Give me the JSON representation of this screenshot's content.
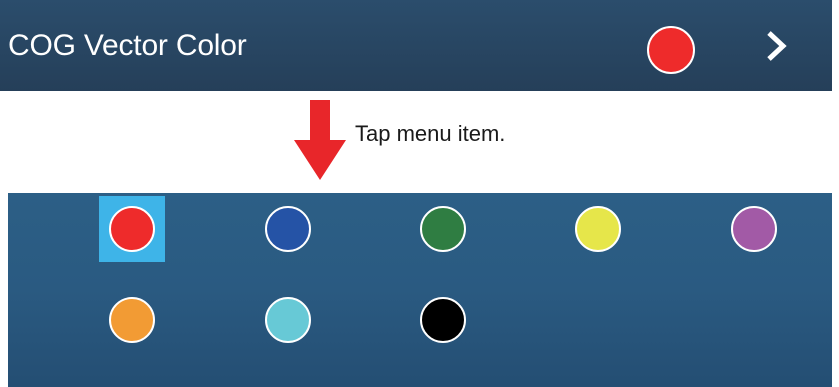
{
  "menu": {
    "label": "COG Vector Color",
    "current_color": "#ee2b2b",
    "chevron_icon": "chevron-right-icon"
  },
  "instruction": {
    "arrow_icon": "arrow-down-icon",
    "arrow_color": "#e8262a",
    "text": "Tap menu item."
  },
  "palette": {
    "selected_index": 0,
    "colors": [
      {
        "name": "red",
        "hex": "#ee2b2b"
      },
      {
        "name": "blue",
        "hex": "#2553a6"
      },
      {
        "name": "green",
        "hex": "#2f7d42"
      },
      {
        "name": "yellow",
        "hex": "#e6e64a"
      },
      {
        "name": "purple",
        "hex": "#a25aa6"
      },
      {
        "name": "orange",
        "hex": "#f29b34"
      },
      {
        "name": "cyan",
        "hex": "#67c9d6"
      },
      {
        "name": "black",
        "hex": "#000000"
      }
    ]
  }
}
